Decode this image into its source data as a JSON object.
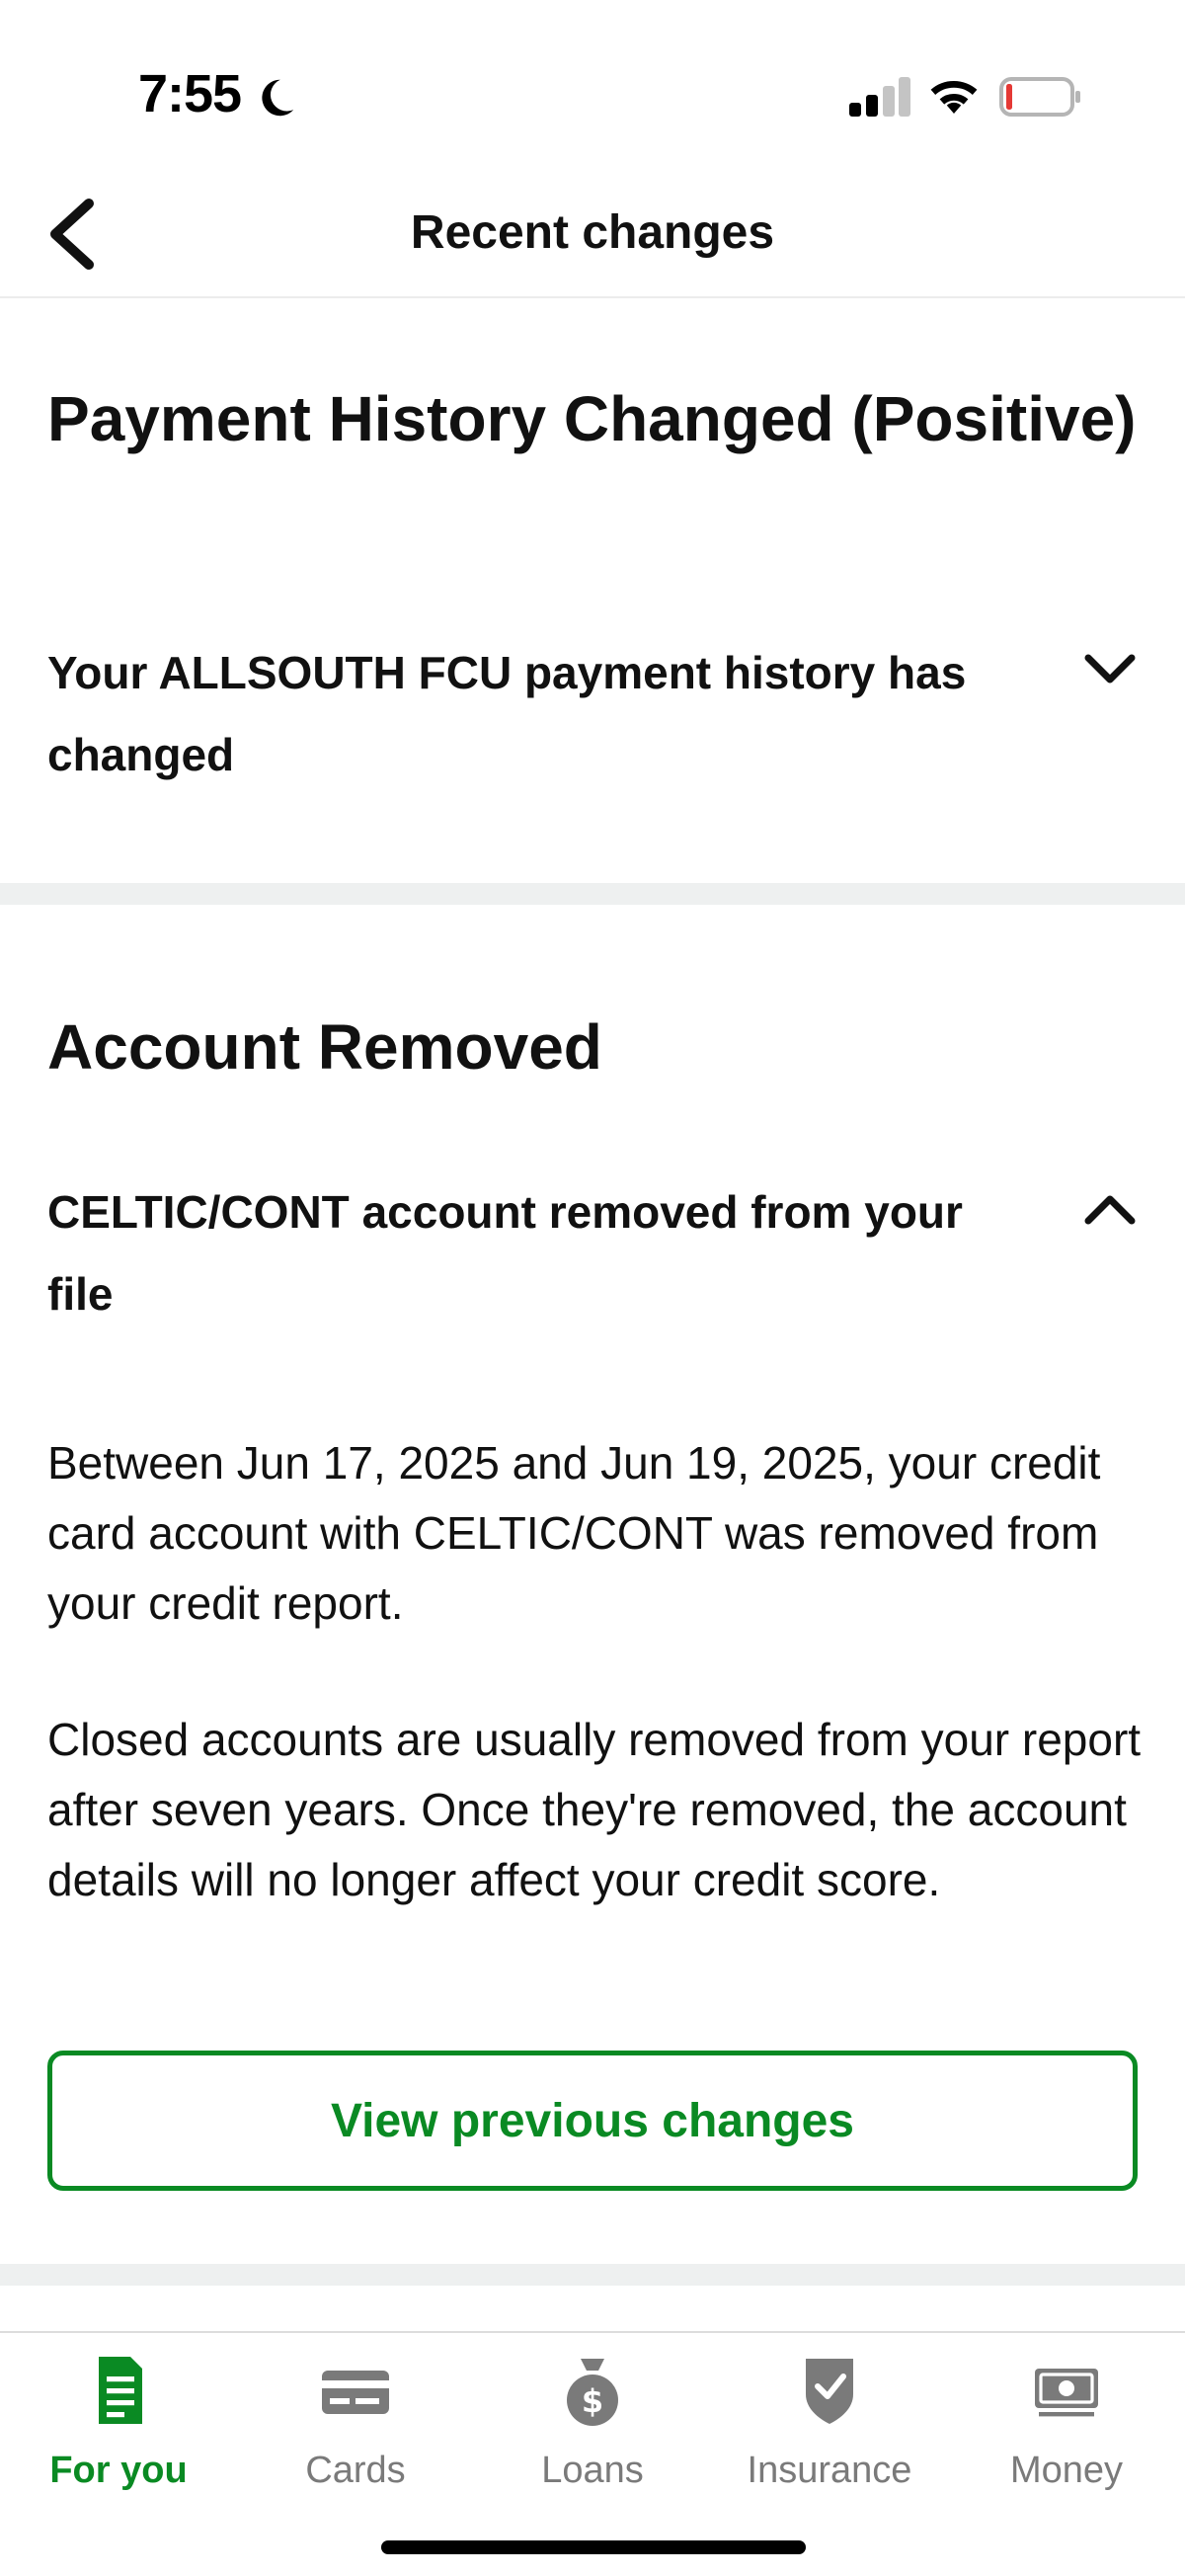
{
  "status_bar": {
    "time": "7:55",
    "icons": [
      "moon-icon",
      "signal-icon",
      "wifi-icon",
      "battery-icon"
    ],
    "battery_color": "#e53935"
  },
  "header": {
    "title": "Recent changes",
    "back_icon": "chevron-left-icon"
  },
  "sections": [
    {
      "title": "Payment History Changed (Positive)",
      "accordion": {
        "label": "Your ALLSOUTH FCU payment history has changed",
        "expanded": false,
        "icon": "chevron-down-icon"
      }
    },
    {
      "title": "Account Removed",
      "accordion": {
        "label": "CELTIC/CONT account removed from your file",
        "expanded": true,
        "icon": "chevron-up-icon"
      },
      "body": [
        "Between Jun 17, 2025 and Jun 19, 2025, your credit card account with CELTIC/CONT was removed from your credit report.",
        "Closed accounts are usually removed from your report after seven years. Once they're removed, the account details will no longer affect your credit score."
      ],
      "button_label": "View previous changes"
    }
  ],
  "tab_bar": {
    "tabs": [
      {
        "label": "For you",
        "icon": "document-icon",
        "active": true
      },
      {
        "label": "Cards",
        "icon": "credit-card-icon",
        "active": false
      },
      {
        "label": "Loans",
        "icon": "money-bag-icon",
        "active": false
      },
      {
        "label": "Insurance",
        "icon": "shield-check-icon",
        "active": false
      },
      {
        "label": "Money",
        "icon": "banknote-icon",
        "active": false
      }
    ]
  },
  "colors": {
    "accent": "#0a8a23",
    "inactive_tab": "#7a7a7a",
    "divider": "#eef0f0"
  }
}
